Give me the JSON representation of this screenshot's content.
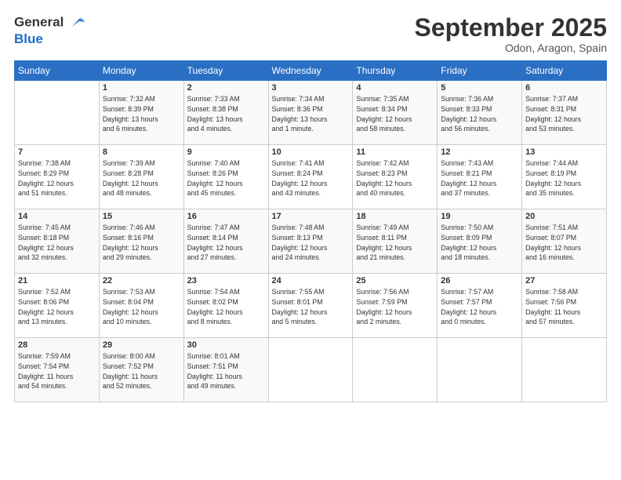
{
  "logo": {
    "line1": "General",
    "line2": "Blue"
  },
  "title": "September 2025",
  "subtitle": "Odon, Aragon, Spain",
  "weekdays": [
    "Sunday",
    "Monday",
    "Tuesday",
    "Wednesday",
    "Thursday",
    "Friday",
    "Saturday"
  ],
  "weeks": [
    [
      {
        "day": "",
        "info": ""
      },
      {
        "day": "1",
        "info": "Sunrise: 7:32 AM\nSunset: 8:39 PM\nDaylight: 13 hours\nand 6 minutes."
      },
      {
        "day": "2",
        "info": "Sunrise: 7:33 AM\nSunset: 8:38 PM\nDaylight: 13 hours\nand 4 minutes."
      },
      {
        "day": "3",
        "info": "Sunrise: 7:34 AM\nSunset: 8:36 PM\nDaylight: 13 hours\nand 1 minute."
      },
      {
        "day": "4",
        "info": "Sunrise: 7:35 AM\nSunset: 8:34 PM\nDaylight: 12 hours\nand 58 minutes."
      },
      {
        "day": "5",
        "info": "Sunrise: 7:36 AM\nSunset: 8:33 PM\nDaylight: 12 hours\nand 56 minutes."
      },
      {
        "day": "6",
        "info": "Sunrise: 7:37 AM\nSunset: 8:31 PM\nDaylight: 12 hours\nand 53 minutes."
      }
    ],
    [
      {
        "day": "7",
        "info": "Sunrise: 7:38 AM\nSunset: 8:29 PM\nDaylight: 12 hours\nand 51 minutes."
      },
      {
        "day": "8",
        "info": "Sunrise: 7:39 AM\nSunset: 8:28 PM\nDaylight: 12 hours\nand 48 minutes."
      },
      {
        "day": "9",
        "info": "Sunrise: 7:40 AM\nSunset: 8:26 PM\nDaylight: 12 hours\nand 45 minutes."
      },
      {
        "day": "10",
        "info": "Sunrise: 7:41 AM\nSunset: 8:24 PM\nDaylight: 12 hours\nand 43 minutes."
      },
      {
        "day": "11",
        "info": "Sunrise: 7:42 AM\nSunset: 8:23 PM\nDaylight: 12 hours\nand 40 minutes."
      },
      {
        "day": "12",
        "info": "Sunrise: 7:43 AM\nSunset: 8:21 PM\nDaylight: 12 hours\nand 37 minutes."
      },
      {
        "day": "13",
        "info": "Sunrise: 7:44 AM\nSunset: 8:19 PM\nDaylight: 12 hours\nand 35 minutes."
      }
    ],
    [
      {
        "day": "14",
        "info": "Sunrise: 7:45 AM\nSunset: 8:18 PM\nDaylight: 12 hours\nand 32 minutes."
      },
      {
        "day": "15",
        "info": "Sunrise: 7:46 AM\nSunset: 8:16 PM\nDaylight: 12 hours\nand 29 minutes."
      },
      {
        "day": "16",
        "info": "Sunrise: 7:47 AM\nSunset: 8:14 PM\nDaylight: 12 hours\nand 27 minutes."
      },
      {
        "day": "17",
        "info": "Sunrise: 7:48 AM\nSunset: 8:13 PM\nDaylight: 12 hours\nand 24 minutes."
      },
      {
        "day": "18",
        "info": "Sunrise: 7:49 AM\nSunset: 8:11 PM\nDaylight: 12 hours\nand 21 minutes."
      },
      {
        "day": "19",
        "info": "Sunrise: 7:50 AM\nSunset: 8:09 PM\nDaylight: 12 hours\nand 18 minutes."
      },
      {
        "day": "20",
        "info": "Sunrise: 7:51 AM\nSunset: 8:07 PM\nDaylight: 12 hours\nand 16 minutes."
      }
    ],
    [
      {
        "day": "21",
        "info": "Sunrise: 7:52 AM\nSunset: 8:06 PM\nDaylight: 12 hours\nand 13 minutes."
      },
      {
        "day": "22",
        "info": "Sunrise: 7:53 AM\nSunset: 8:04 PM\nDaylight: 12 hours\nand 10 minutes."
      },
      {
        "day": "23",
        "info": "Sunrise: 7:54 AM\nSunset: 8:02 PM\nDaylight: 12 hours\nand 8 minutes."
      },
      {
        "day": "24",
        "info": "Sunrise: 7:55 AM\nSunset: 8:01 PM\nDaylight: 12 hours\nand 5 minutes."
      },
      {
        "day": "25",
        "info": "Sunrise: 7:56 AM\nSunset: 7:59 PM\nDaylight: 12 hours\nand 2 minutes."
      },
      {
        "day": "26",
        "info": "Sunrise: 7:57 AM\nSunset: 7:57 PM\nDaylight: 12 hours\nand 0 minutes."
      },
      {
        "day": "27",
        "info": "Sunrise: 7:58 AM\nSunset: 7:56 PM\nDaylight: 11 hours\nand 57 minutes."
      }
    ],
    [
      {
        "day": "28",
        "info": "Sunrise: 7:59 AM\nSunset: 7:54 PM\nDaylight: 11 hours\nand 54 minutes."
      },
      {
        "day": "29",
        "info": "Sunrise: 8:00 AM\nSunset: 7:52 PM\nDaylight: 11 hours\nand 52 minutes."
      },
      {
        "day": "30",
        "info": "Sunrise: 8:01 AM\nSunset: 7:51 PM\nDaylight: 11 hours\nand 49 minutes."
      },
      {
        "day": "",
        "info": ""
      },
      {
        "day": "",
        "info": ""
      },
      {
        "day": "",
        "info": ""
      },
      {
        "day": "",
        "info": ""
      }
    ]
  ]
}
